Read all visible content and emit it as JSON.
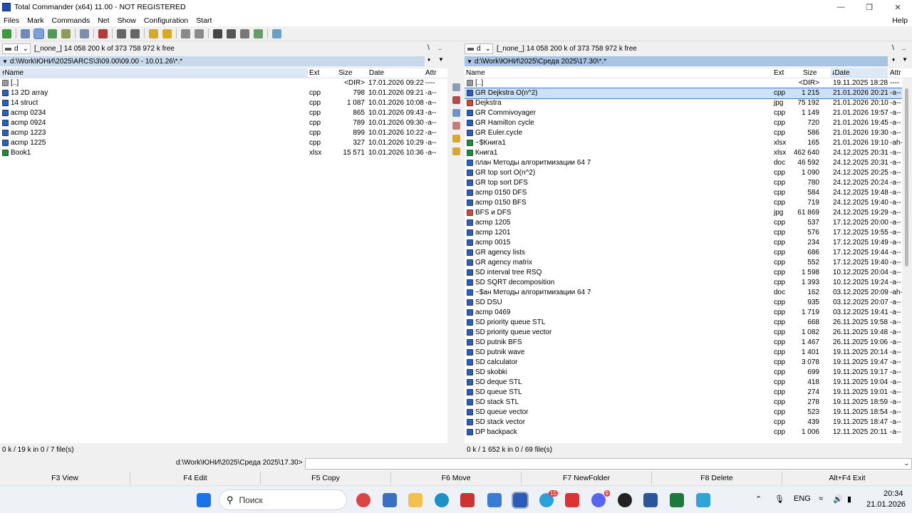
{
  "window": {
    "title": "Total Commander (x64) 11.00 - NOT REGISTERED",
    "help": "Help"
  },
  "menu": [
    "Files",
    "Mark",
    "Commands",
    "Net",
    "Show",
    "Configuration",
    "Start"
  ],
  "left": {
    "drive": "d",
    "drive_info": "[_none_]  14 058 200 k of 373 758 972 k free",
    "nav_root": "\\",
    "nav_up": "..",
    "path": "d:\\Work\\ЮНИ\\2025\\ARCS\\3\\09.00\\09.00 - 10.01.26\\*.*",
    "headers": {
      "name": "Name",
      "ext": "Ext",
      "size": "Size",
      "date": "Date",
      "attr": "Attr"
    },
    "rows": [
      {
        "name": "[..]",
        "ext": "",
        "size": "<DIR>",
        "date": "17.01.2026 09:22",
        "attr": "----",
        "icon": "up"
      },
      {
        "name": "13 2D array",
        "ext": "cpp",
        "size": "798",
        "date": "10.01.2026 09:21",
        "attr": "-a--",
        "icon": "cpp"
      },
      {
        "name": "14 struct",
        "ext": "cpp",
        "size": "1 087",
        "date": "10.01.2026 10:08",
        "attr": "-a--",
        "icon": "cpp"
      },
      {
        "name": "acmp 0234",
        "ext": "cpp",
        "size": "865",
        "date": "10.01.2026 09:43",
        "attr": "-a--",
        "icon": "cpp"
      },
      {
        "name": "acmp 0924",
        "ext": "cpp",
        "size": "789",
        "date": "10.01.2026 09:30",
        "attr": "-a--",
        "icon": "cpp"
      },
      {
        "name": "acmp 1223",
        "ext": "cpp",
        "size": "899",
        "date": "10.01.2026 10:22",
        "attr": "-a--",
        "icon": "cpp"
      },
      {
        "name": "acmp 1225",
        "ext": "cpp",
        "size": "327",
        "date": "10.01.2026 10:29",
        "attr": "-a--",
        "icon": "cpp"
      },
      {
        "name": "Book1",
        "ext": "xlsx",
        "size": "15 571",
        "date": "10.01.2026 10:36",
        "attr": "-a--",
        "icon": "xlsx"
      }
    ],
    "status": "0 k / 19 k in 0 / 7 file(s)"
  },
  "right": {
    "drive": "d",
    "drive_info": "[_none_]  14 058 200 k of 373 758 972 k free",
    "nav_root": "\\",
    "nav_up": "..",
    "path": "d:\\Work\\ЮНИ\\2025\\Среда 2025\\17.30\\*.*",
    "headers": {
      "name": "Name",
      "ext": "Ext",
      "size": "Size",
      "date": "Date",
      "attr": "Attr"
    },
    "rows": [
      {
        "name": "[..]",
        "ext": "",
        "size": "<DIR>",
        "date": "19.11.2025 18:28",
        "attr": "----",
        "icon": "up"
      },
      {
        "name": "GR Dejkstra O(n^2)",
        "ext": "cpp",
        "size": "1 215",
        "date": "21.01.2026 20:21",
        "attr": "-a--",
        "icon": "cpp"
      },
      {
        "name": "Dejkstra",
        "ext": "jpg",
        "size": "75 192",
        "date": "21.01.2026 20:10",
        "attr": "-a--",
        "icon": "jpg"
      },
      {
        "name": "GR Commivoyager",
        "ext": "cpp",
        "size": "1 149",
        "date": "21.01.2026 19:57",
        "attr": "-a--",
        "icon": "cpp"
      },
      {
        "name": "GR Hamilton cycle",
        "ext": "cpp",
        "size": "720",
        "date": "21.01.2026 19:45",
        "attr": "-a--",
        "icon": "cpp"
      },
      {
        "name": "GR Euler.cycle",
        "ext": "cpp",
        "size": "586",
        "date": "21.01.2026 19:30",
        "attr": "-a--",
        "icon": "cpp"
      },
      {
        "name": "~$Книга1",
        "ext": "xlsx",
        "size": "165",
        "date": "21.01.2026 19:10",
        "attr": "-ah-",
        "icon": "xlsx"
      },
      {
        "name": "Книга1",
        "ext": "xlsx",
        "size": "462 640",
        "date": "24.12.2025 20:31",
        "attr": "-a--",
        "icon": "xlsx"
      },
      {
        "name": "план Методы алгоритмизации 64 7",
        "ext": "doc",
        "size": "46 592",
        "date": "24.12.2025 20:31",
        "attr": "-a--",
        "icon": "doc"
      },
      {
        "name": "GR top sort O(n^2)",
        "ext": "cpp",
        "size": "1 090",
        "date": "24.12.2025 20:25",
        "attr": "-a--",
        "icon": "cpp"
      },
      {
        "name": "GR top sort DFS",
        "ext": "cpp",
        "size": "780",
        "date": "24.12.2025 20:24",
        "attr": "-a--",
        "icon": "cpp"
      },
      {
        "name": "acmp 0150 DFS",
        "ext": "cpp",
        "size": "584",
        "date": "24.12.2025 19:48",
        "attr": "-a--",
        "icon": "cpp"
      },
      {
        "name": "acmp 0150 BFS",
        "ext": "cpp",
        "size": "719",
        "date": "24.12.2025 19:40",
        "attr": "-a--",
        "icon": "cpp"
      },
      {
        "name": "BFS и DFS",
        "ext": "jpg",
        "size": "61 869",
        "date": "24.12.2025 19:29",
        "attr": "-a--",
        "icon": "jpg"
      },
      {
        "name": "acmp 1205",
        "ext": "cpp",
        "size": "537",
        "date": "17.12.2025 20:00",
        "attr": "-a--",
        "icon": "cpp"
      },
      {
        "name": "acmp 1201",
        "ext": "cpp",
        "size": "576",
        "date": "17.12.2025 19:55",
        "attr": "-a--",
        "icon": "cpp"
      },
      {
        "name": "acmp 0015",
        "ext": "cpp",
        "size": "234",
        "date": "17.12.2025 19:49",
        "attr": "-a--",
        "icon": "cpp"
      },
      {
        "name": "GR agency lists",
        "ext": "cpp",
        "size": "686",
        "date": "17.12.2025 19:44",
        "attr": "-a--",
        "icon": "cpp"
      },
      {
        "name": "GR agency matrix",
        "ext": "cpp",
        "size": "552",
        "date": "17.12.2025 19:40",
        "attr": "-a--",
        "icon": "cpp"
      },
      {
        "name": "SD interval tree RSQ",
        "ext": "cpp",
        "size": "1 598",
        "date": "10.12.2025 20:04",
        "attr": "-a--",
        "icon": "cpp"
      },
      {
        "name": "SD SQRT decomposition",
        "ext": "cpp",
        "size": "1 393",
        "date": "10.12.2025 19:24",
        "attr": "-a--",
        "icon": "cpp"
      },
      {
        "name": "~$ан Методы алгоритмизации 64 7",
        "ext": "doc",
        "size": "162",
        "date": "03.12.2025 20:09",
        "attr": "-ah-",
        "icon": "doc"
      },
      {
        "name": "SD DSU",
        "ext": "cpp",
        "size": "935",
        "date": "03.12.2025 20:07",
        "attr": "-a--",
        "icon": "cpp"
      },
      {
        "name": "acmp 0469",
        "ext": "cpp",
        "size": "1 719",
        "date": "03.12.2025 19:41",
        "attr": "-a--",
        "icon": "cpp"
      },
      {
        "name": "SD priority queue STL",
        "ext": "cpp",
        "size": "668",
        "date": "26.11.2025 19:58",
        "attr": "-a--",
        "icon": "cpp"
      },
      {
        "name": "SD priority queue vector",
        "ext": "cpp",
        "size": "1 082",
        "date": "26.11.2025 19:48",
        "attr": "-a--",
        "icon": "cpp"
      },
      {
        "name": "SD putnik BFS",
        "ext": "cpp",
        "size": "1 467",
        "date": "26.11.2025 19:06",
        "attr": "-a--",
        "icon": "cpp"
      },
      {
        "name": "SD putnik wave",
        "ext": "cpp",
        "size": "1 401",
        "date": "19.11.2025 20:14",
        "attr": "-a--",
        "icon": "cpp"
      },
      {
        "name": "SD calculator",
        "ext": "cpp",
        "size": "3 078",
        "date": "19.11.2025 19:47",
        "attr": "-a--",
        "icon": "cpp"
      },
      {
        "name": "SD skobki",
        "ext": "cpp",
        "size": "699",
        "date": "19.11.2025 19:17",
        "attr": "-a--",
        "icon": "cpp"
      },
      {
        "name": "SD deque STL",
        "ext": "cpp",
        "size": "418",
        "date": "19.11.2025 19:04",
        "attr": "-a--",
        "icon": "cpp"
      },
      {
        "name": "SD queue STL",
        "ext": "cpp",
        "size": "274",
        "date": "19.11.2025 19:01",
        "attr": "-a--",
        "icon": "cpp"
      },
      {
        "name": "SD stack STL",
        "ext": "cpp",
        "size": "278",
        "date": "19.11.2025 18:59",
        "attr": "-a--",
        "icon": "cpp"
      },
      {
        "name": "SD queue vector",
        "ext": "cpp",
        "size": "523",
        "date": "19.11.2025 18:54",
        "attr": "-a--",
        "icon": "cpp"
      },
      {
        "name": "SD stack vector",
        "ext": "cpp",
        "size": "439",
        "date": "19.11.2025 18:47",
        "attr": "-a--",
        "icon": "cpp"
      },
      {
        "name": "DP backpack",
        "ext": "cpp",
        "size": "1 006",
        "date": "12.11.2025 20:11",
        "attr": "-a--",
        "icon": "cpp"
      }
    ],
    "status": "0 k / 1 652 k in 0 / 69 file(s)"
  },
  "cmdline": {
    "prompt": "d:\\Work\\ЮНИ\\2025\\Среда 2025\\17.30>"
  },
  "fkeys": [
    "F3 View",
    "F4 Edit",
    "F5 Copy",
    "F6 Move",
    "F7 NewFolder",
    "F8 Delete",
    "Alt+F4 Exit"
  ],
  "taskbar": {
    "search_placeholder": "Поиск",
    "telegram_badge": "15",
    "discord_badge": "9",
    "lang": "ENG",
    "time": "20:34",
    "date": "21.01.2026"
  },
  "colors": {
    "selection": "#cde0f7",
    "active_path": "#a9c4e3",
    "cpp_icon": "#2f5fb5",
    "xlsx_icon": "#1f8b3e",
    "jpg_icon": "#c94b3b"
  }
}
